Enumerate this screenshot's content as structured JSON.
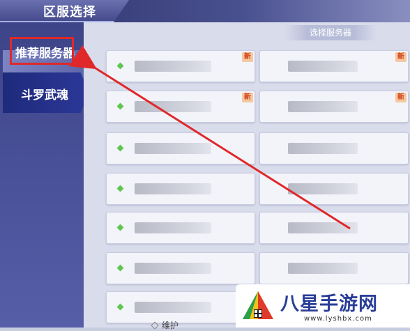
{
  "window": {
    "title": "区服选择"
  },
  "sidebar": {
    "items": [
      {
        "label": "推荐服务器",
        "selected": true,
        "highlighted": true
      },
      {
        "label": "斗罗武魂",
        "selected": false
      }
    ]
  },
  "main": {
    "header": "选择服务器",
    "servers": [
      {
        "status_color": "#5fc64e",
        "is_new": true
      },
      {
        "status_color": "#5fc64e",
        "is_new": true
      },
      {
        "status_color": "#5fc64e",
        "is_new": true
      },
      {
        "status_color": "#5fc64e",
        "is_new": true
      },
      {
        "status_color": "#5fc64e",
        "is_new": false
      },
      {
        "status_color": "#5fc64e",
        "is_new": false
      },
      {
        "status_color": "#5fc64e",
        "is_new": false
      },
      {
        "status_color": "#5fc64e",
        "is_new": false
      },
      {
        "status_color": "#5fc64e",
        "is_new": false
      },
      {
        "status_color": "#5fc64e",
        "is_new": false
      },
      {
        "status_color": "#5fc64e",
        "is_new": false
      },
      {
        "status_color": "#5fc64e",
        "is_new": false
      },
      {
        "status_color": "#5fc64e",
        "is_new": false
      },
      {
        "status_color": "#5fc64e",
        "is_new": false
      }
    ],
    "new_badge": "新",
    "legend": {
      "maintenance_label": "维护"
    }
  },
  "annotation": {
    "box_color": "#e0282a",
    "arrow_color": "#e0282a"
  },
  "watermark": {
    "text": "八星手游网",
    "url": "www.lyshbx.com"
  }
}
